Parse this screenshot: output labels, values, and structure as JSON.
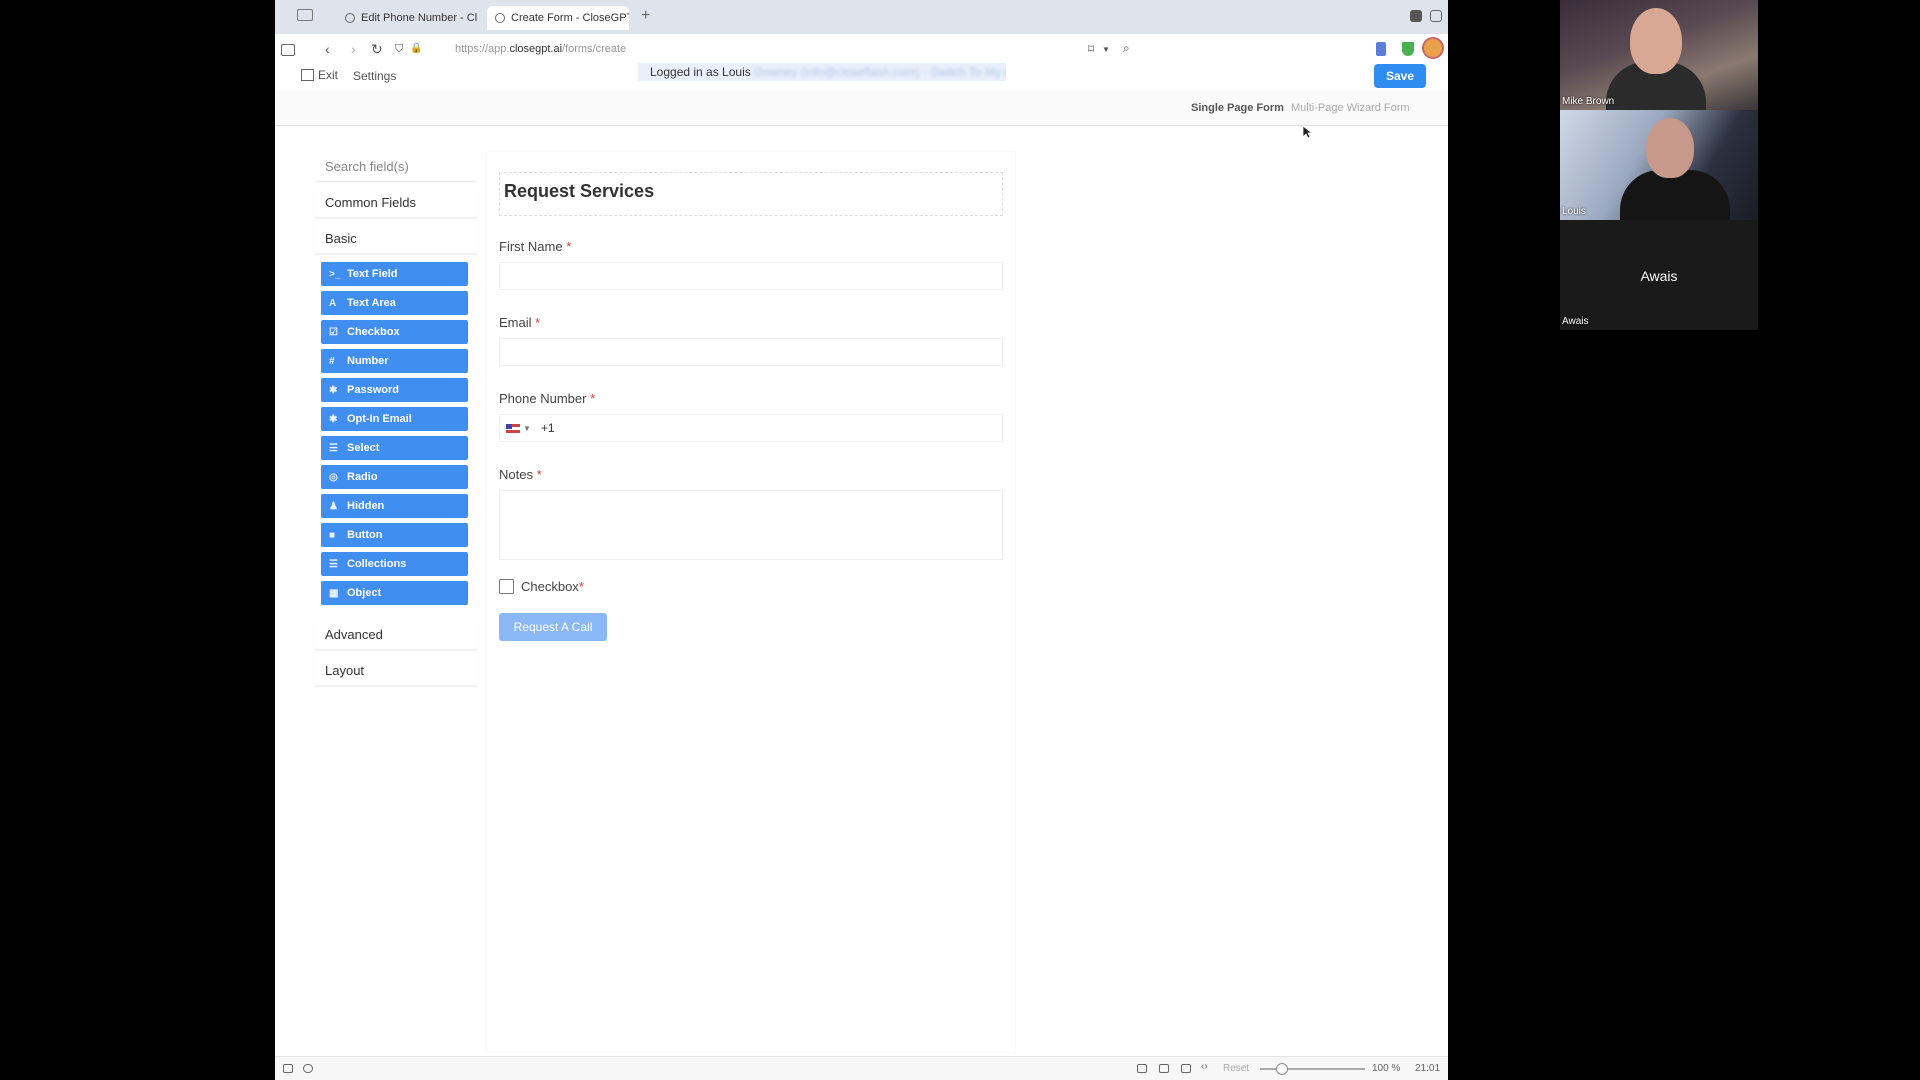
{
  "browser": {
    "tabs": [
      {
        "label": "Edit Phone Number - Clos"
      },
      {
        "label": "Create Form - CloseGPT"
      }
    ],
    "new_tab": "+",
    "url_prefix": "https://app.",
    "url_domain": "closegpt.ai",
    "url_path": "/forms/create"
  },
  "header": {
    "exit_label": "Exit",
    "settings_label": "Settings",
    "logged_in_prefix": "Logged in as Louis",
    "logged_in_blurred": "Downey (info@closeflash.com) - Switch To My Account",
    "save_label": "Save"
  },
  "form_modes": {
    "single": "Single Page Form",
    "multi": "Multi-Page Wizard Form"
  },
  "panel": {
    "search_placeholder": "Search field(s)",
    "common_fields": "Common Fields",
    "basic": "Basic",
    "basic_fields": [
      {
        "icon": ">_",
        "label": "Text Field"
      },
      {
        "icon": "A",
        "label": "Text Area"
      },
      {
        "icon": "☑",
        "label": "Checkbox"
      },
      {
        "icon": "#",
        "label": "Number"
      },
      {
        "icon": "✱",
        "label": "Password"
      },
      {
        "icon": "✱",
        "label": "Opt-In Email"
      },
      {
        "icon": "☰",
        "label": "Select"
      },
      {
        "icon": "◎",
        "label": "Radio"
      },
      {
        "icon": "♟",
        "label": "Hidden"
      },
      {
        "icon": "■",
        "label": "Button"
      },
      {
        "icon": "☰",
        "label": "Collections"
      },
      {
        "icon": "▦",
        "label": "Object"
      }
    ],
    "advanced": "Advanced",
    "layout": "Layout"
  },
  "form": {
    "title": "Request Services",
    "first_name_label": "First Name",
    "email_label": "Email",
    "phone_label": "Phone Number",
    "phone_value": "+1",
    "notes_label": "Notes",
    "checkbox_label": "Checkbox",
    "required_mark": "*",
    "submit_label": "Request A Call"
  },
  "statusbar": {
    "reset": "Reset",
    "zoom": "100 %",
    "time": "21:01"
  },
  "video_call": {
    "participants": [
      {
        "name": "Mike Brown"
      },
      {
        "name": "Louis"
      },
      {
        "name": "Awais"
      }
    ]
  },
  "colors": {
    "primary_button": "#3f8ef0",
    "save_button": "#2f8cf0",
    "submit_button": "#8ab7f5",
    "required": "#e03c3c"
  }
}
